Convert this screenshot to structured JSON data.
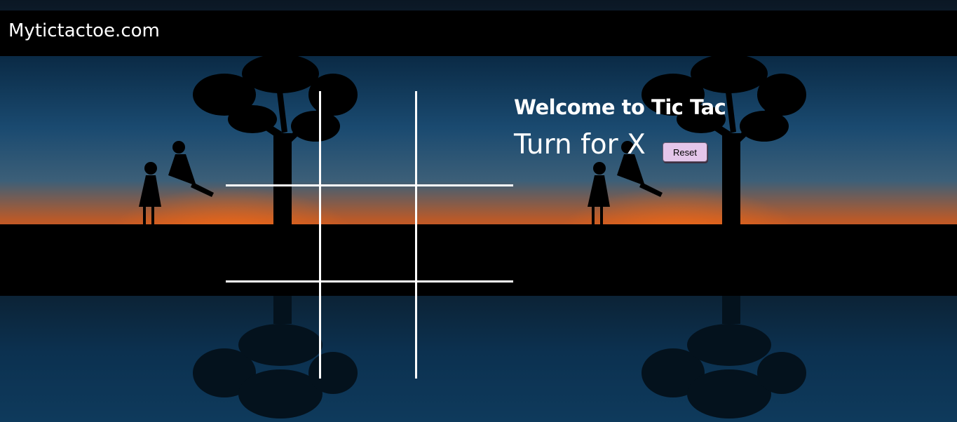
{
  "navbar": {
    "brand": "Mytictactoe.com"
  },
  "game": {
    "title": "Welcome to Tic Tac",
    "turn_text": "Turn for X",
    "reset_label": "Reset",
    "cells": [
      "",
      "",
      "",
      "",
      "",
      "",
      "",
      "",
      ""
    ]
  },
  "colors": {
    "navbar_bg": "#000000",
    "grid_lines": "#ffffff",
    "reset_button_bg": "#e4c6ea",
    "text": "#ffffff"
  }
}
